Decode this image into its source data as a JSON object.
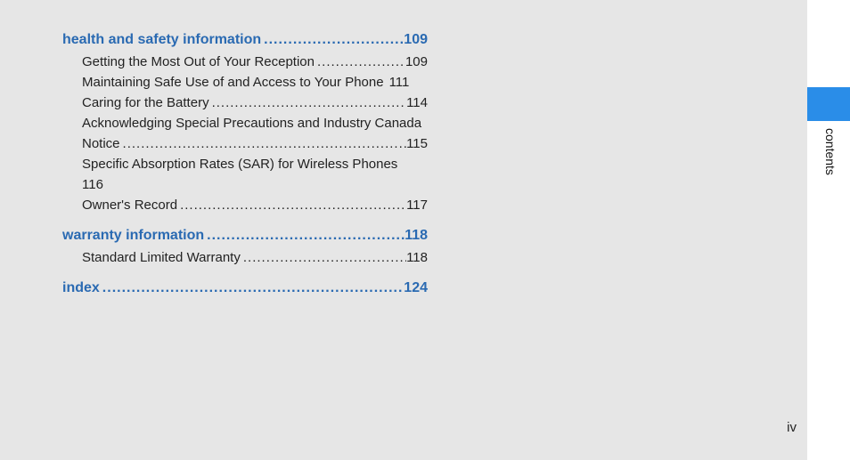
{
  "dots": "........................................................................................................................",
  "sections": [
    {
      "title": "health and safety information",
      "page": "109",
      "entries": [
        {
          "type": "line",
          "title": "Getting the Most Out of Your Reception",
          "page": "109"
        },
        {
          "type": "tight",
          "title": "Maintaining Safe Use of and Access to Your Phone",
          "page": "111"
        },
        {
          "type": "line",
          "title": "Caring for the Battery",
          "page": "114"
        },
        {
          "type": "wrap",
          "text1": "Acknowledging Special Precautions and Industry Canada",
          "text2_title": "Notice",
          "text2_page": "115"
        },
        {
          "type": "wrap_plain",
          "text1": "Specific Absorption Rates (SAR) for Wireless Phones",
          "text2": "116"
        },
        {
          "type": "line",
          "title": "Owner's Record",
          "page": "117"
        }
      ]
    },
    {
      "title": "warranty information",
      "page": "118",
      "entries": [
        {
          "type": "line",
          "title": "Standard Limited Warranty",
          "page": "118"
        }
      ]
    },
    {
      "title": "index",
      "page": "124",
      "entries": []
    }
  ],
  "side_label": "contents",
  "page_number": "iv"
}
